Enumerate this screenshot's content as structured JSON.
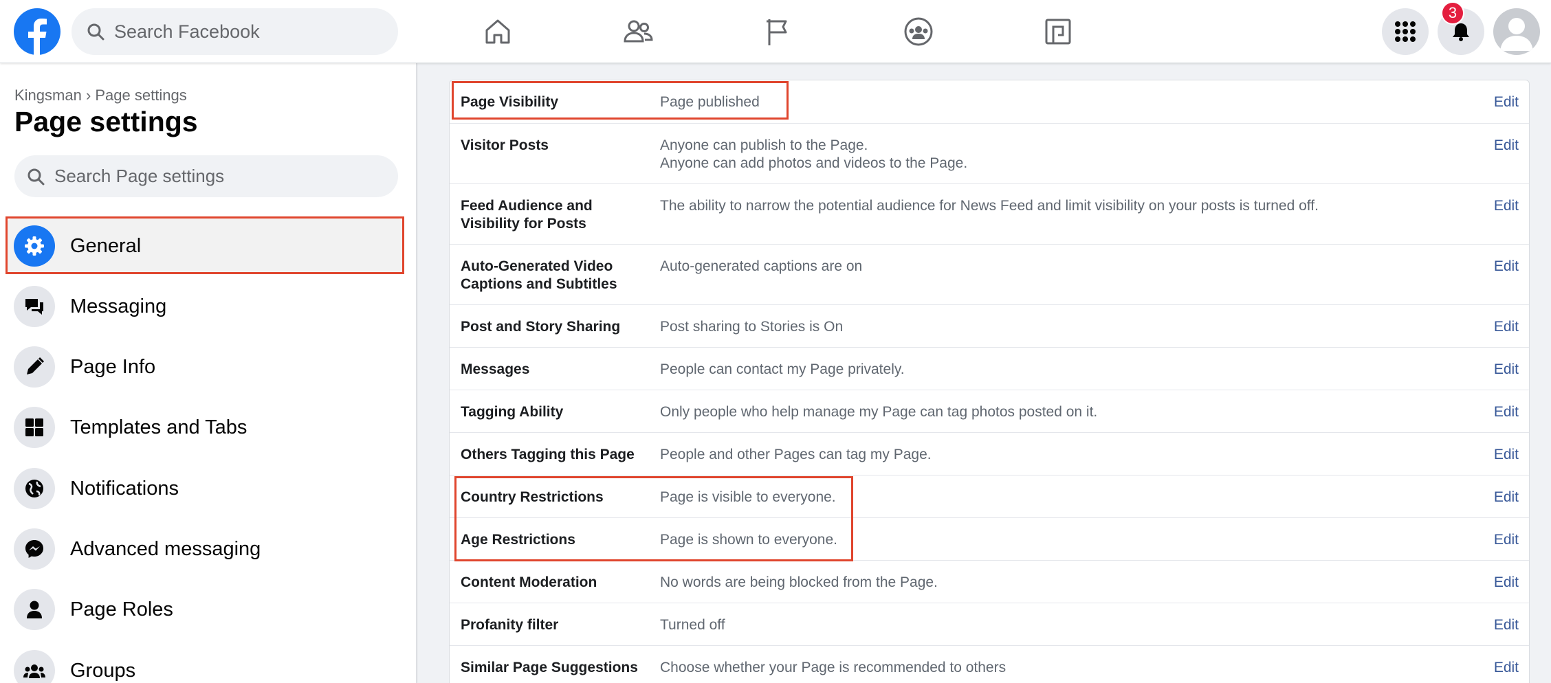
{
  "topbar": {
    "search_placeholder": "Search Facebook",
    "notification_count": "3",
    "icons": [
      "facebook-logo",
      "search-icon",
      "home-icon",
      "friends-icon",
      "pages-flag-icon",
      "groups-icon",
      "gaming-icon",
      "menu-grid-icon",
      "bell-icon",
      "avatar"
    ]
  },
  "sidebar": {
    "breadcrumb": "Kingsman › Page settings",
    "title": "Page settings",
    "search_placeholder": "Search Page settings",
    "items": [
      {
        "label": "General",
        "icon": "gear-icon",
        "active": true
      },
      {
        "label": "Messaging",
        "icon": "chat-bubbles-icon"
      },
      {
        "label": "Page Info",
        "icon": "pencil-icon"
      },
      {
        "label": "Templates and Tabs",
        "icon": "grid-icon"
      },
      {
        "label": "Notifications",
        "icon": "globe-icon"
      },
      {
        "label": "Advanced messaging",
        "icon": "messenger-icon"
      },
      {
        "label": "Page Roles",
        "icon": "person-icon"
      },
      {
        "label": "Groups",
        "icon": "group-icon"
      }
    ]
  },
  "settings": {
    "edit_label": "Edit",
    "rows": [
      {
        "label": "Page Visibility",
        "value": "Page published"
      },
      {
        "label": "Visitor Posts",
        "value": "Anyone can publish to the Page.",
        "value2": "Anyone can add photos and videos to the Page."
      },
      {
        "label": "Feed Audience and Visibility for Posts",
        "value": "The ability to narrow the potential audience for News Feed and limit visibility on your posts is turned off."
      },
      {
        "label": "Auto-Generated Video Captions and Subtitles",
        "value": "Auto-generated captions are on"
      },
      {
        "label": "Post and Story Sharing",
        "value": "Post sharing to Stories is On"
      },
      {
        "label": "Messages",
        "value": "People can contact my Page privately."
      },
      {
        "label": "Tagging Ability",
        "value": "Only people who help manage my Page can tag photos posted on it."
      },
      {
        "label": "Others Tagging this Page",
        "value": "People and other Pages can tag my Page."
      },
      {
        "label": "Country Restrictions",
        "value": "Page is visible to everyone."
      },
      {
        "label": "Age Restrictions",
        "value": "Page is shown to everyone."
      },
      {
        "label": "Content Moderation",
        "value": "No words are being blocked from the Page."
      },
      {
        "label": "Profanity filter",
        "value": "Turned off"
      },
      {
        "label": "Similar Page Suggestions",
        "value": "Choose whether your Page is recommended to others"
      }
    ]
  },
  "colors": {
    "brand": "#1877f2",
    "link": "#385898",
    "highlight": "#e0452d",
    "badge": "#e41e3f"
  }
}
